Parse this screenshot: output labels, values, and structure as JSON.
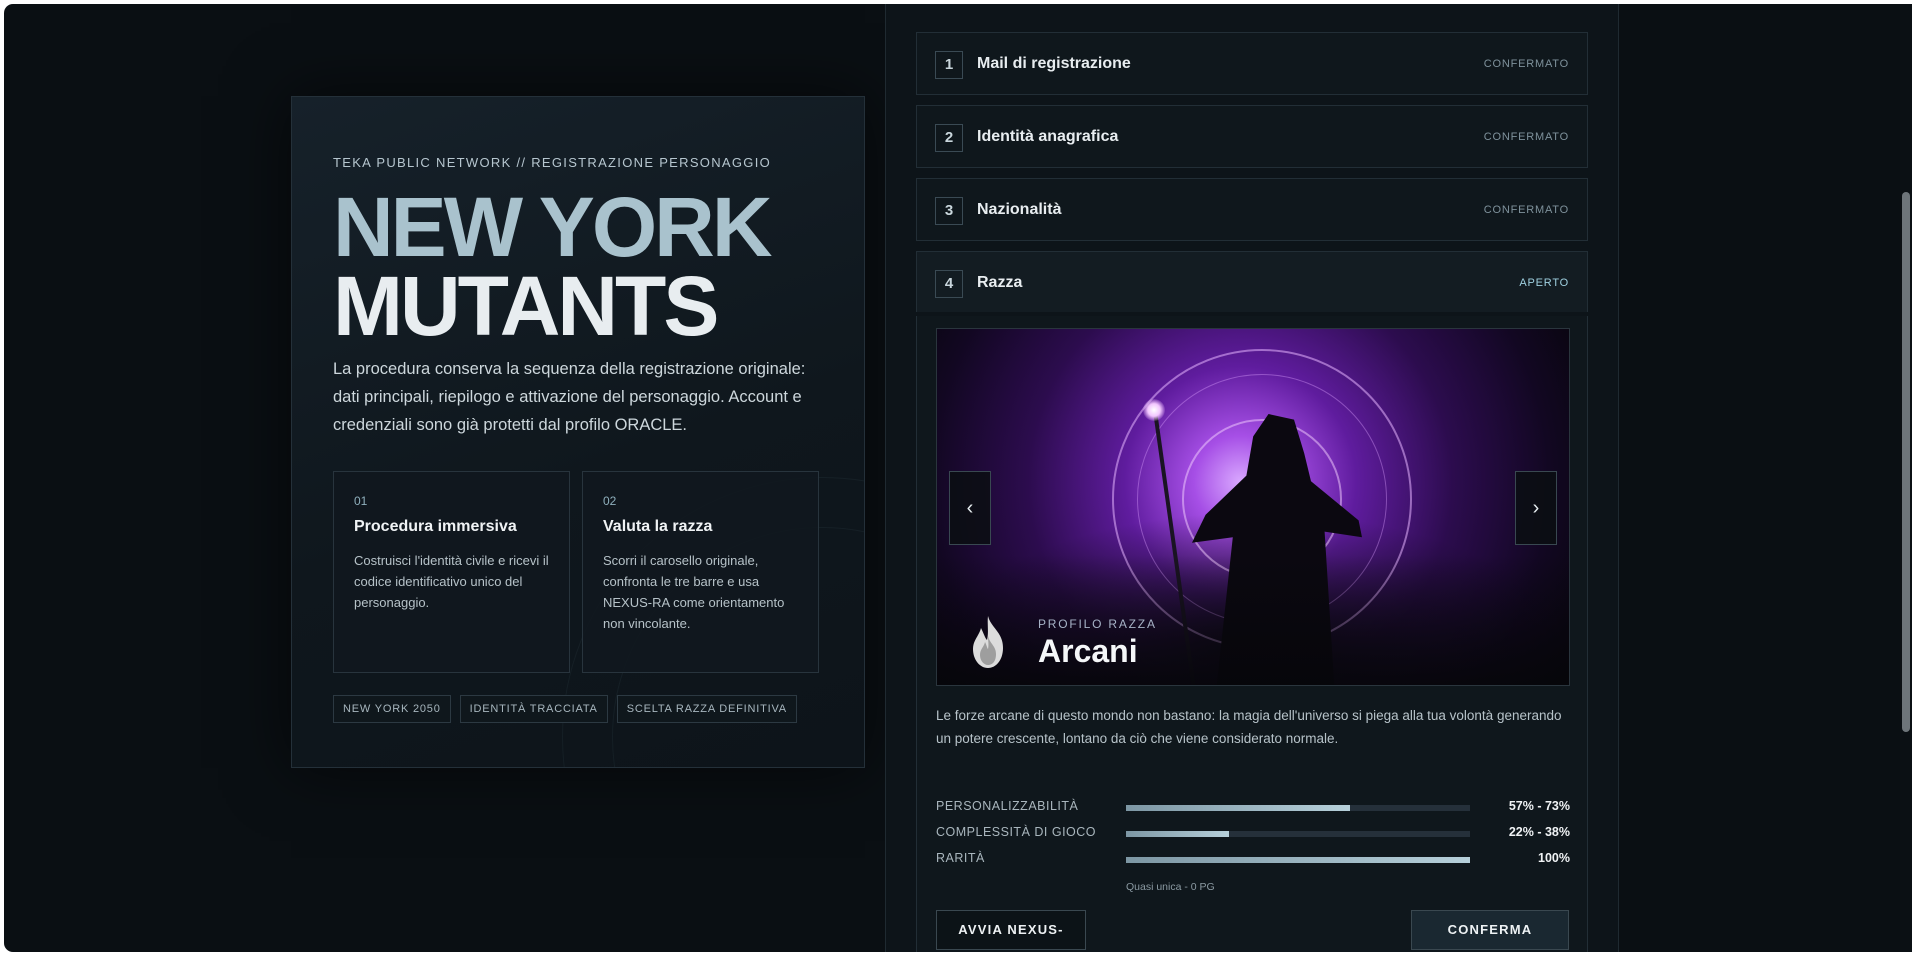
{
  "hero": {
    "kicker": "TEKA PUBLIC NETWORK // REGISTRAZIONE PERSONAGGIO",
    "title_line1": "NEW YORK",
    "title_line2": "MUTANTS",
    "intro": "La procedura conserva la sequenza della registrazione originale: dati principali, riepilogo e attivazione del personaggio. Account e credenziali sono già protetti dal profilo ORACLE.",
    "features": [
      {
        "num": "01",
        "title": "Procedura immersiva",
        "text": "Costruisci l'identità civile e ricevi il codice identificativo unico del personaggio."
      },
      {
        "num": "02",
        "title": "Valuta la razza",
        "text": "Scorri il carosello originale, confronta le tre barre e usa NEXUS-RA come orientamento non vincolante."
      }
    ],
    "tags": [
      "NEW YORK 2050",
      "IDENTITÀ TRACCIATA",
      "SCELTA RAZZA DEFINITIVA"
    ]
  },
  "steps": [
    {
      "num": "1",
      "title": "Mail di registrazione",
      "status": "CONFERMATO"
    },
    {
      "num": "2",
      "title": "Identità anagrafica",
      "status": "CONFERMATO"
    },
    {
      "num": "3",
      "title": "Nazionalità",
      "status": "CONFERMATO"
    },
    {
      "num": "4",
      "title": "Razza",
      "status": "APERTO"
    }
  ],
  "race": {
    "carousel_prev": "‹",
    "carousel_next": "›",
    "profile_label": "PROFILO RAZZA",
    "name": "Arcani",
    "icon": "fire-icon",
    "description": "Le forze arcane di questo mondo non bastano: la magia dell'universo si piega alla tua volontà generando un potere crescente, lontano da ciò che viene considerato normale.",
    "stats": [
      {
        "label": "PERSONALIZZABILITÀ",
        "value": "57% - 73%",
        "fill": 0.65
      },
      {
        "label": "COMPLESSITÀ DI GIOCO",
        "value": "22% - 38%",
        "fill": 0.3
      },
      {
        "label": "RARITÀ",
        "value": "100%",
        "fill": 1.0
      }
    ],
    "rarity_note": "Quasi unica - 0 PG",
    "btn_nexus": "AVVIA NEXUS-RA",
    "btn_confirm": "CONFERMA RAZZA"
  },
  "colors": {
    "background": "#0a0f13",
    "accent": "#a9c2cd",
    "open_status": "#9fd0e0"
  }
}
